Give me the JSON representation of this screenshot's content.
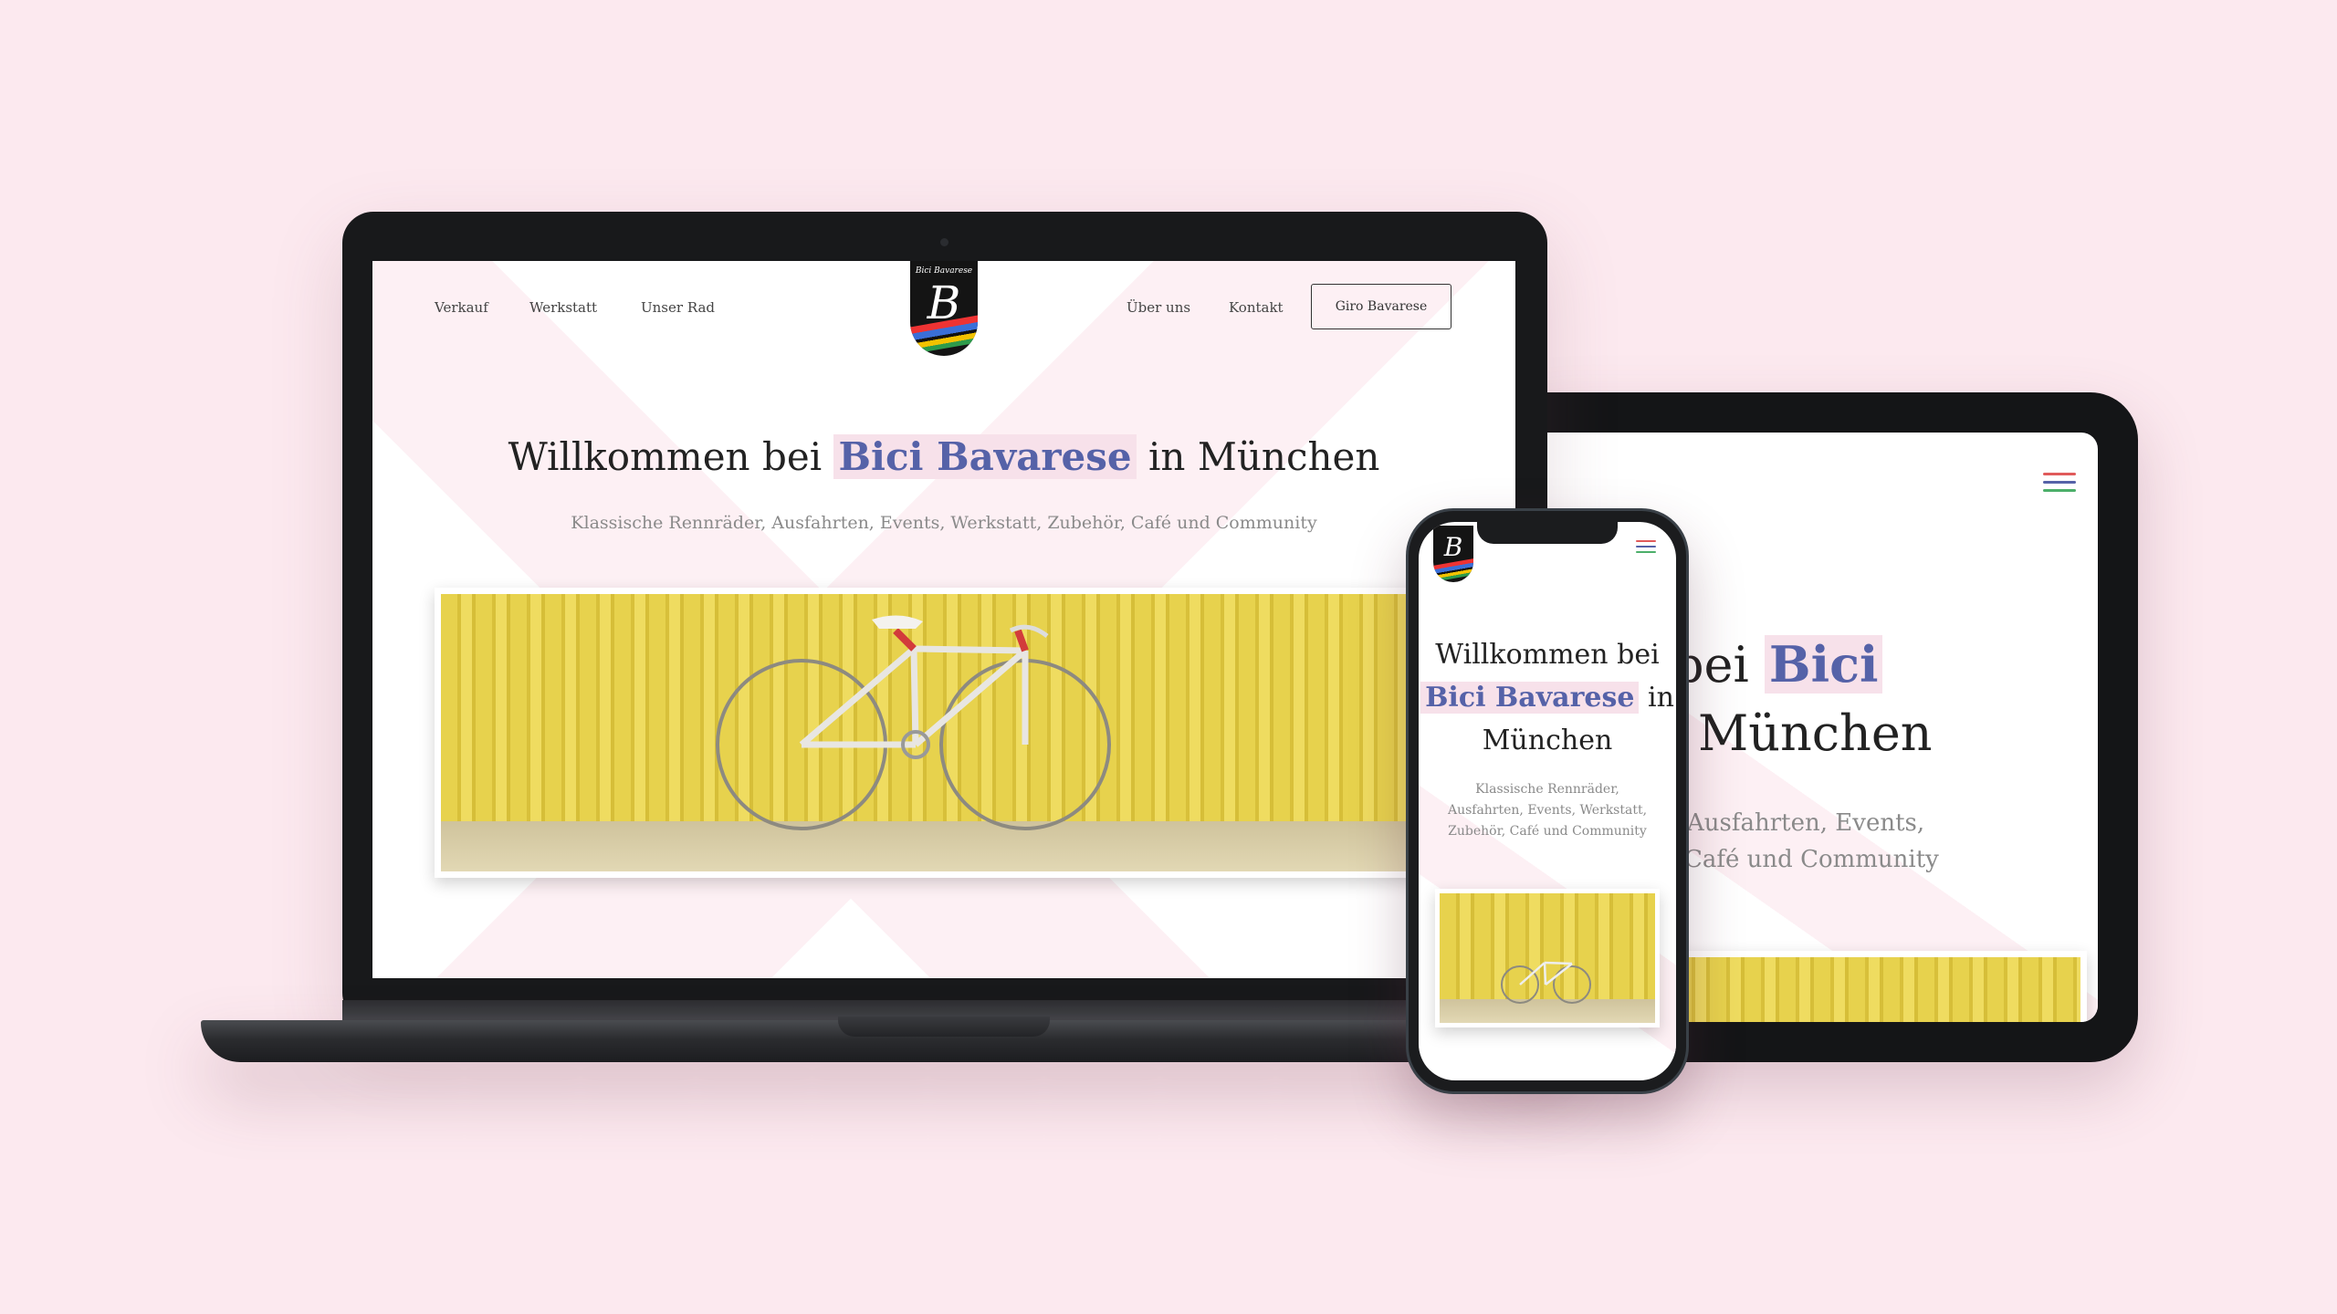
{
  "site": {
    "nav_left": [
      "Verkauf",
      "Werkstatt",
      "Unser Rad"
    ],
    "nav_right": [
      "Über uns",
      "Kontakt"
    ],
    "cta": "Giro Bavarese",
    "logo_text": "Bici Bavarese",
    "title_pre": "Willkommen bei",
    "title_highlight": "Bici Bavarese",
    "title_post": "in München",
    "subtitle": "Klassische Rennräder, Ausfahrten, Events, Werkstatt,  Zubehör, Café und Community"
  },
  "tablet": {
    "title_line1_fragment": "n bei",
    "title_line1_highlight": "Bici",
    "title_line2_fragment": "n München",
    "sub_line1": "Ausfahrten, Events,",
    "sub_line2": "Café und Community"
  },
  "phone": {
    "title_line1": "Willkommen bei",
    "title_highlight": "Bici Bavarese",
    "title_mid": "in",
    "title_line3": "München",
    "sub_line1": "Klassische Rennräder,",
    "sub_line2": "Ausfahrten, Events, Werkstatt,",
    "sub_line3": "Zubehör, Café und Community"
  },
  "colors": {
    "background": "#fce9ef",
    "accent": "#5562a8",
    "highlight": "#f7e1ea",
    "hero_yellow": "#e7d24d"
  },
  "icons": {
    "menu": "hamburger-menu-icon",
    "logo": "bici-bavarese-logo"
  }
}
